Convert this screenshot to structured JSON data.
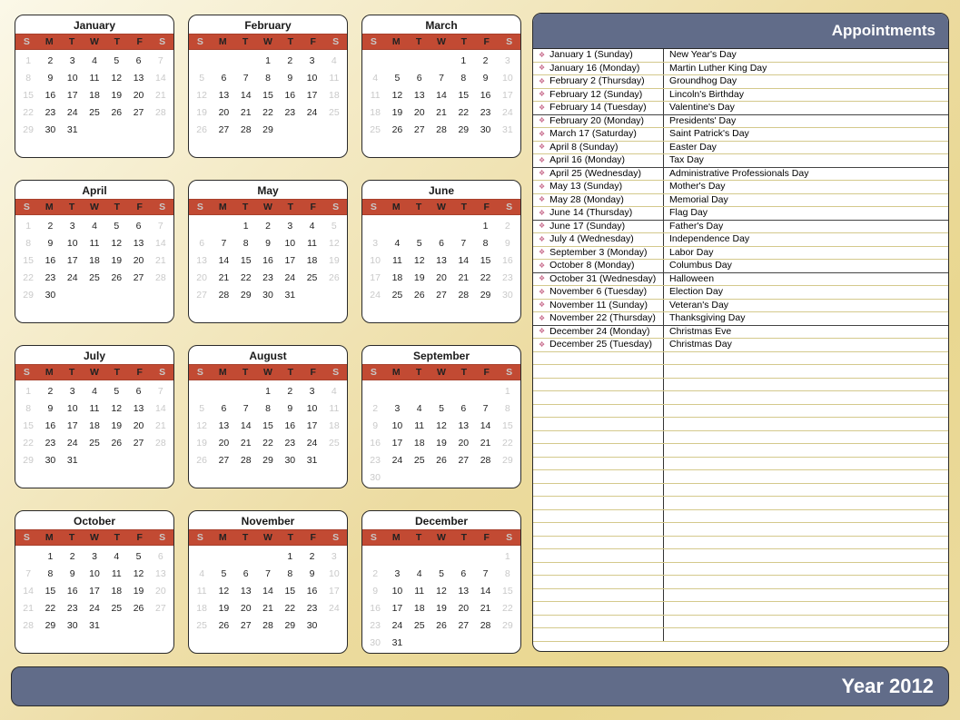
{
  "year_label": "Year 2012",
  "appointments_title": "Appointments",
  "dow": [
    "S",
    "M",
    "T",
    "W",
    "T",
    "F",
    "S"
  ],
  "months": [
    {
      "name": "January",
      "start": 0,
      "len": 31
    },
    {
      "name": "February",
      "start": 3,
      "len": 29
    },
    {
      "name": "March",
      "start": 4,
      "len": 31
    },
    {
      "name": "April",
      "start": 0,
      "len": 30
    },
    {
      "name": "May",
      "start": 2,
      "len": 31
    },
    {
      "name": "June",
      "start": 5,
      "len": 30
    },
    {
      "name": "July",
      "start": 0,
      "len": 31
    },
    {
      "name": "August",
      "start": 3,
      "len": 31
    },
    {
      "name": "September",
      "start": 6,
      "len": 30
    },
    {
      "name": "October",
      "start": 1,
      "len": 31
    },
    {
      "name": "November",
      "start": 4,
      "len": 30
    },
    {
      "name": "December",
      "start": 6,
      "len": 31
    }
  ],
  "appointments": [
    {
      "date": "January 1 (Sunday)",
      "name": "New Year's Day"
    },
    {
      "date": "January 16 (Monday)",
      "name": "Martin Luther King Day"
    },
    {
      "date": "February 2 (Thursday)",
      "name": "Groundhog Day"
    },
    {
      "date": "February 12 (Sunday)",
      "name": "Lincoln's Birthday"
    },
    {
      "date": "February 14 (Tuesday)",
      "name": "Valentine's Day",
      "dark": true
    },
    {
      "date": "February 20 (Monday)",
      "name": "Presidents' Day"
    },
    {
      "date": "March 17 (Saturday)",
      "name": "Saint Patrick's Day"
    },
    {
      "date": "April 8 (Sunday)",
      "name": "Easter Day"
    },
    {
      "date": "April 16 (Monday)",
      "name": "Tax Day",
      "dark": true
    },
    {
      "date": "April 25 (Wednesday)",
      "name": "Administrative Professionals Day"
    },
    {
      "date": "May 13 (Sunday)",
      "name": "Mother's Day"
    },
    {
      "date": "May 28 (Monday)",
      "name": "Memorial Day"
    },
    {
      "date": "June 14 (Thursday)",
      "name": "Flag Day",
      "dark": true
    },
    {
      "date": "June 17 (Sunday)",
      "name": "Father's Day"
    },
    {
      "date": "July 4 (Wednesday)",
      "name": "Independence Day"
    },
    {
      "date": "September 3 (Monday)",
      "name": "Labor Day"
    },
    {
      "date": "October 8 (Monday)",
      "name": "Columbus Day",
      "dark": true
    },
    {
      "date": "October 31 (Wednesday)",
      "name": "Halloween"
    },
    {
      "date": "November 6 (Tuesday)",
      "name": "Election Day"
    },
    {
      "date": "November 11 (Sunday)",
      "name": "Veteran's Day"
    },
    {
      "date": "November 22 (Thursday)",
      "name": "Thanksgiving Day",
      "dark": true
    },
    {
      "date": "December 24 (Monday)",
      "name": "Christmas Eve"
    },
    {
      "date": "December 25 (Tuesday)",
      "name": "Christmas Day"
    }
  ],
  "blank_rows": 22
}
